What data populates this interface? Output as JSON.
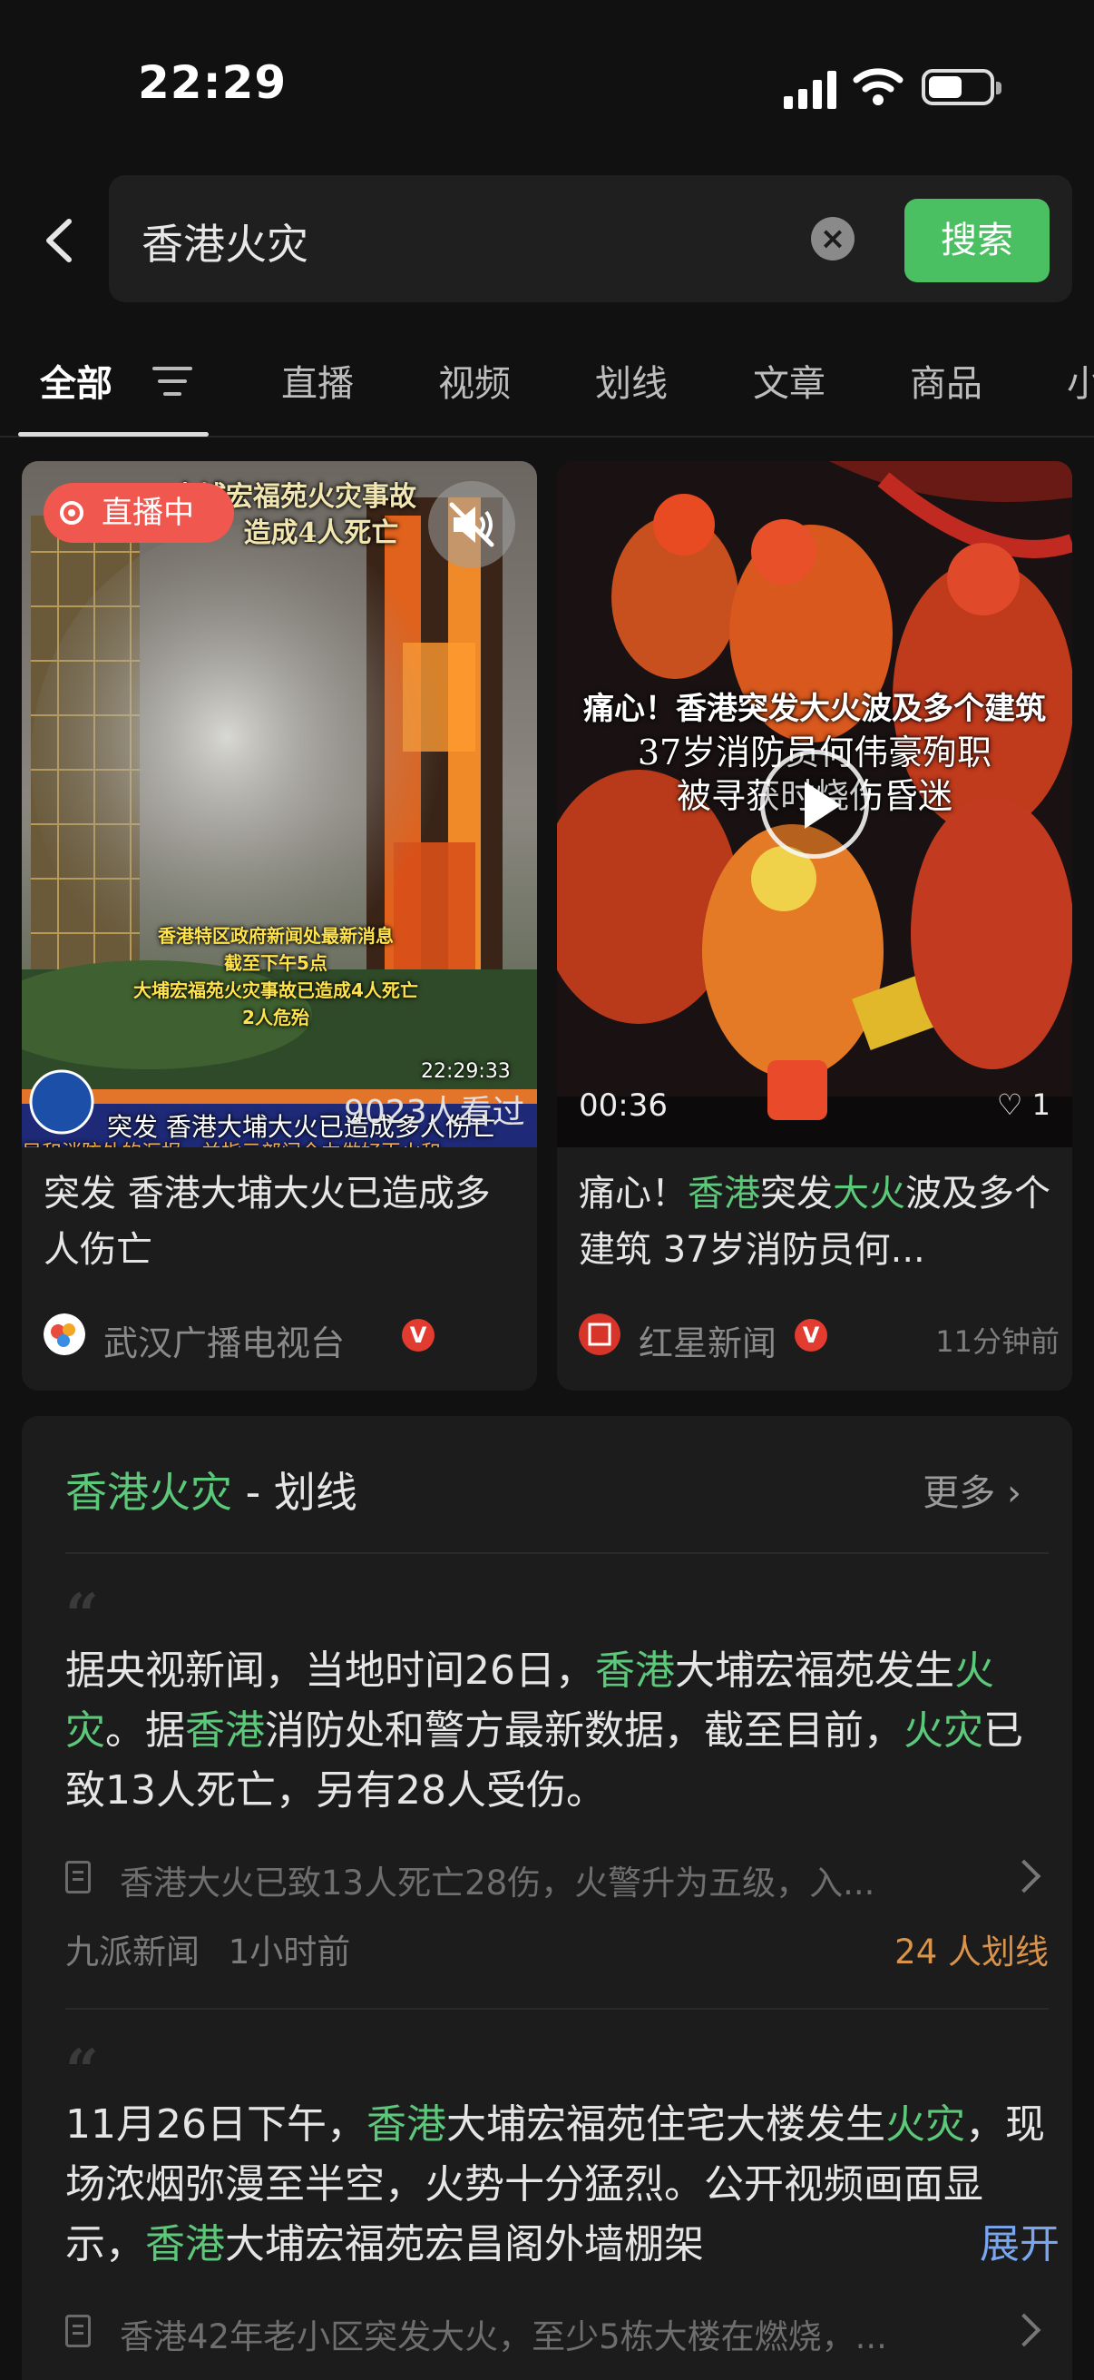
{
  "status_bar": {
    "time": "22:29"
  },
  "search": {
    "query": "香港火灾",
    "button_label": "搜索"
  },
  "tabs": [
    {
      "label": "全部",
      "active": true
    },
    {
      "label": "直播"
    },
    {
      "label": "视频"
    },
    {
      "label": "划线"
    },
    {
      "label": "文章"
    },
    {
      "label": "商品"
    },
    {
      "label": "小"
    }
  ],
  "cards": [
    {
      "badge": "直播中",
      "overlay_headline": "大埔宏福苑火灾事故",
      "overlay_headline2": "造成4人死亡",
      "overlay_note": [
        "香港特区政府新闻处最新消息",
        "截至下午5点",
        "大埔宏福苑火灾事故已造成4人死亡",
        "2人危殆"
      ],
      "overlay_clock": "22:29:33",
      "overlay_ticker": "突发  香港大埔大火已造成多人伤亡",
      "overlay_bottom": "局和消防处的汇报，并指示部门全力做好灭火和",
      "viewers": "9023人看过",
      "title": "突发 香港大埔大火已造成多人伤亡",
      "source": "武汉广播电视台"
    },
    {
      "overlay_line1": "痛心！香港突发大火波及多个建筑",
      "overlay_line2": "37岁消防员何伟豪殉职",
      "overlay_line3": "被寻获时烧伤昏迷",
      "duration": "00:36",
      "likes": "1",
      "title_parts": [
        "痛心！",
        "香港",
        "突发",
        "大火",
        "波及多个建筑 37岁消防员何..."
      ],
      "source": "红星新闻",
      "time_ago": "11分钟前"
    }
  ],
  "highlight_section": {
    "title_keyword": "香港火灾",
    "title_suffix": " - 划线",
    "more_label": "更多",
    "items": [
      {
        "text_parts": [
          "据央视新闻，当地时间26日，",
          "香港",
          "大埔宏福苑发生",
          "火灾",
          "。据",
          "香港",
          "消防处和警方最新数据，截至目前，",
          "火灾",
          "已致13人死亡，另有28人受伤。"
        ],
        "source_title": "香港大火已致13人死亡28伤，火警升为五级，入...",
        "publisher": "九派新闻",
        "time": "1小时前",
        "count": "24 人划线"
      },
      {
        "text_parts": [
          "11月26日下午，",
          "香港",
          "大埔宏福苑住宅大楼发生",
          "火灾",
          "，现场浓烟弥漫至半空，火势十分猛烈。公开视频画面显示，",
          "香港",
          "大埔宏福苑宏昌阁外墙棚架"
        ],
        "expand_label": "展开",
        "source_title": "香港42年老小区突发大火，至少5栋大楼在燃烧，..."
      }
    ]
  },
  "colors": {
    "accent_green": "#4ac063",
    "highlight_green": "#5cc87a",
    "live_red": "#f0574e",
    "count_orange": "#d9934a"
  }
}
